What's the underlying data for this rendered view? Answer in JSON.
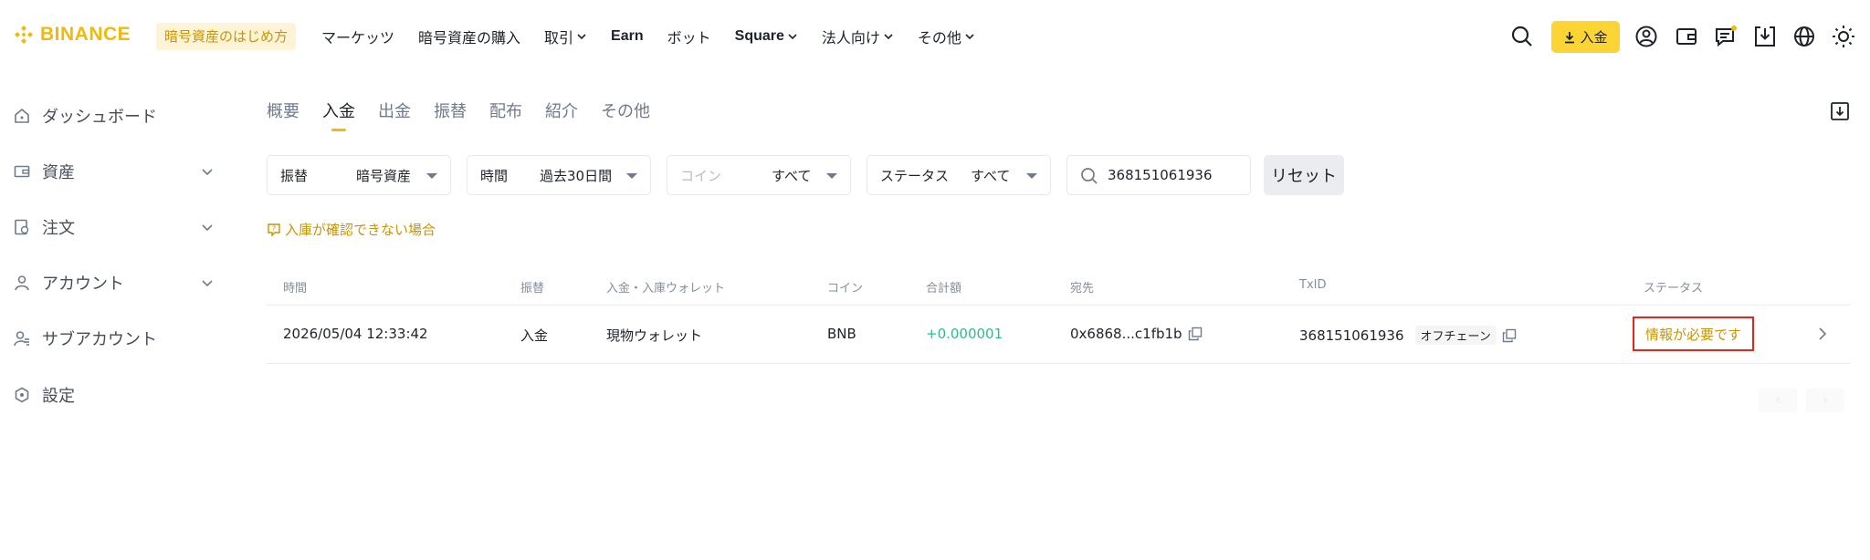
{
  "brand": {
    "name": "BINANCE",
    "color": "#F0B90B"
  },
  "promo": {
    "label": "暗号資産のはじめ方"
  },
  "nav": [
    {
      "label": "マーケッツ",
      "dropdown": false,
      "bold": false
    },
    {
      "label": "暗号資産の購入",
      "dropdown": false,
      "bold": false
    },
    {
      "label": "取引",
      "dropdown": true,
      "bold": false
    },
    {
      "label": "Earn",
      "dropdown": false,
      "bold": true
    },
    {
      "label": "ボット",
      "dropdown": false,
      "bold": false
    },
    {
      "label": "Square",
      "dropdown": true,
      "bold": true
    },
    {
      "label": "法人向け",
      "dropdown": true,
      "bold": false
    },
    {
      "label": "その他",
      "dropdown": true,
      "bold": false
    }
  ],
  "header_actions": {
    "deposit_label": "入金"
  },
  "sidebar": {
    "items": [
      {
        "label": "ダッシュボード",
        "icon": "home-icon",
        "expandable": false
      },
      {
        "label": "資産",
        "icon": "wallet-icon",
        "expandable": true
      },
      {
        "label": "注文",
        "icon": "orders-icon",
        "expandable": true
      },
      {
        "label": "アカウント",
        "icon": "user-icon",
        "expandable": true
      },
      {
        "label": "サブアカウント",
        "icon": "sub-account-icon",
        "expandable": false
      },
      {
        "label": "設定",
        "icon": "settings-icon",
        "expandable": false
      }
    ]
  },
  "tabs": [
    {
      "label": "概要",
      "active": false
    },
    {
      "label": "入金",
      "active": true
    },
    {
      "label": "出金",
      "active": false
    },
    {
      "label": "振替",
      "active": false
    },
    {
      "label": "配布",
      "active": false
    },
    {
      "label": "紹介",
      "active": false
    },
    {
      "label": "その他",
      "active": false
    }
  ],
  "filters": {
    "type": {
      "label": "振替",
      "value": "暗号資産"
    },
    "time": {
      "label": "時間",
      "value": "過去30日間"
    },
    "coin": {
      "label": "コイン",
      "value": "すべて"
    },
    "status": {
      "label": "ステータス",
      "value": "すべて"
    },
    "search": {
      "value": "368151061936"
    },
    "reset_label": "リセット"
  },
  "help_link": {
    "label": "入庫が確認できない場合"
  },
  "table": {
    "headers": {
      "time": "時間",
      "type": "振替",
      "wallet": "入金・入庫ウォレット",
      "coin": "コイン",
      "amount": "合計額",
      "address": "宛先",
      "txid": "TxID",
      "status": "ステータス"
    },
    "rows": [
      {
        "time": "2026/05/04 12:33:42",
        "type": "入金",
        "wallet": "現物ウォレット",
        "coin": "BNB",
        "amount": "+0.000001",
        "address": "0x6868...c1fb1b",
        "txid": "368151061936",
        "chain": "オフチェーン",
        "status": "情報が必要です"
      }
    ]
  },
  "pagination": {
    "prev": "‹",
    "next": "›"
  },
  "colors": {
    "accent": "#FCD535",
    "positive": "#2EBD85",
    "warning": "#C99400",
    "highlight_border": "#E0271B"
  }
}
